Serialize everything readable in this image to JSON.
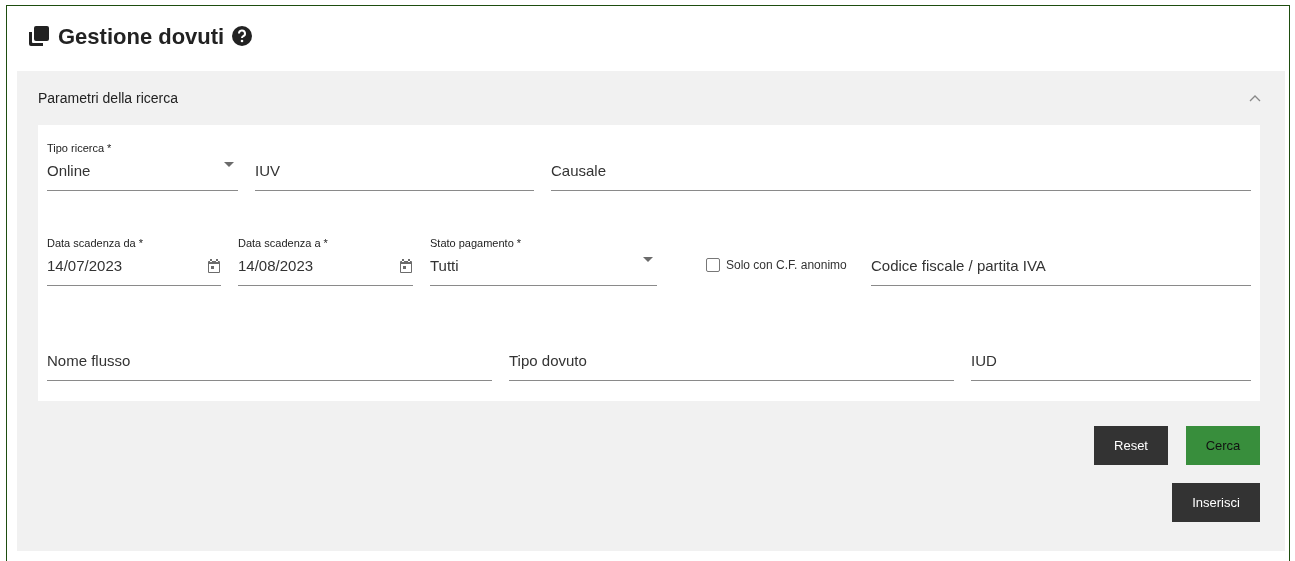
{
  "page": {
    "title": "Gestione dovuti"
  },
  "search_panel": {
    "title": "Parametri della ricerca",
    "expanded": true,
    "field_groups": [
      {
        "fields": [
          {
            "kind": "select",
            "label": "Tipo ricerca *",
            "value": "Online"
          },
          {
            "kind": "text",
            "placeholder": "IUV"
          },
          {
            "kind": "text",
            "placeholder": "Causale"
          }
        ]
      },
      {
        "fields": [
          {
            "kind": "date",
            "label": "Data scadenza da *",
            "value": "14/07/2023"
          },
          {
            "kind": "date",
            "label": "Data scadenza a *",
            "value": "14/08/2023"
          },
          {
            "kind": "select",
            "label": "Stato pagamento *",
            "value": "Tutti"
          },
          {
            "kind": "checkbox",
            "label": "Solo con C.F. anonimo",
            "checked": false
          },
          {
            "kind": "text",
            "placeholder": "Codice fiscale / partita IVA"
          }
        ]
      },
      {
        "fields": [
          {
            "kind": "text",
            "placeholder": "Nome flusso"
          },
          {
            "kind": "text",
            "placeholder": "Tipo dovuto"
          },
          {
            "kind": "text",
            "placeholder": "IUD"
          }
        ]
      }
    ],
    "buttons": [
      {
        "label": "Reset",
        "kind": "secondary"
      },
      {
        "label": "Cerca",
        "kind": "primary"
      }
    ],
    "extra_buttons": [
      {
        "label": "Inserisci",
        "kind": "secondary"
      }
    ]
  }
}
